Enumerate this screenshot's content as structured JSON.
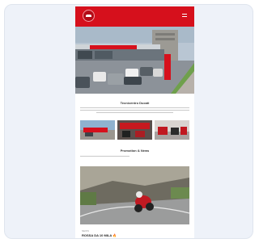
{
  "header": {
    "logo_icon": "ducati-shield-icon",
    "menu_icon": "hamburger-menu-icon",
    "brand_color": "#d6101c"
  },
  "sections": {
    "dealer_title": "Tecnicentro Ducati",
    "promo_title": "Promotion & News"
  },
  "promo": {
    "headline": "ROSSA DA 10 MILA 🔥",
    "label": "NEWS"
  }
}
